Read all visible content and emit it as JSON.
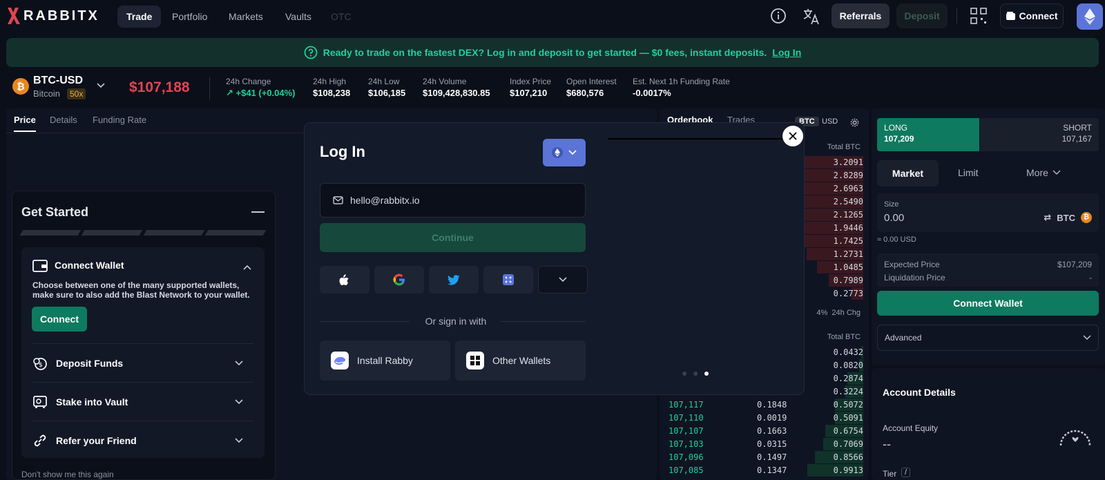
{
  "logo": {
    "text": "RABBITX"
  },
  "nav": {
    "tabs": [
      {
        "label": "Trade"
      },
      {
        "label": "Portfolio"
      },
      {
        "label": "Markets"
      },
      {
        "label": "Vaults"
      },
      {
        "label": "OTC"
      }
    ]
  },
  "topbar": {
    "referrals": "Referrals",
    "deposit": "Deposit",
    "connect": "Connect"
  },
  "banner": {
    "text": "Ready to trade on the fastest DEX? Log in and deposit to get started — $0 fees, instant deposits.",
    "link": "Log In"
  },
  "ticker": {
    "symbol": "BTC-USD",
    "name": "Bitcoin",
    "leverage": "50x",
    "price": "$107,188",
    "stats": [
      {
        "label": "24h Change",
        "value": "↗ +$41 (+0.04%)"
      },
      {
        "label": "24h High",
        "value": "$108,238"
      },
      {
        "label": "24h Low",
        "value": "$106,185"
      },
      {
        "label": "24h Volume",
        "value": "$109,428,830.85"
      },
      {
        "label": "Index Price",
        "value": "$107,210"
      },
      {
        "label": "Open Interest",
        "value": "$680,576"
      },
      {
        "label": "Est. Next 1h Funding Rate",
        "value": "-0.0017%"
      }
    ]
  },
  "chart_tabs": [
    {
      "label": "Price"
    },
    {
      "label": "Details"
    },
    {
      "label": "Funding Rate"
    }
  ],
  "get_started": {
    "title": "Get Started",
    "connect_wallet": {
      "title": "Connect Wallet",
      "description": "Choose between one of the many supported wallets, make sure to also add the Blast Network to your wallet.",
      "button": "Connect"
    },
    "items": [
      {
        "label": "Deposit Funds"
      },
      {
        "label": "Stake into Vault"
      },
      {
        "label": "Refer your Friend"
      }
    ],
    "dont_show": "Don't show me this again"
  },
  "orderbook": {
    "tabs": [
      {
        "label": "Orderbook"
      },
      {
        "label": "Trades"
      }
    ],
    "units": [
      "BTC",
      "USD"
    ],
    "col_total": "Total",
    "col_unit": "BTC",
    "ask_totals": [
      "3.2091",
      "2.8289",
      "2.6963",
      "2.5490",
      "2.1265",
      "1.9446",
      "1.7425",
      "1.2731",
      "1.0485",
      "0.7989",
      "0.2773"
    ],
    "mid": {
      "pct": "4%",
      "label": "24h Chg"
    },
    "bid_totals": [
      "0.0432",
      "0.0820",
      "0.2874",
      "0.3224",
      "0.5072",
      "0.5091",
      "0.6754",
      "0.7069",
      "0.8566",
      "0.9913"
    ],
    "bid_rows": [
      {
        "price": "107,117",
        "size": "0.1848"
      },
      {
        "price": "107,110",
        "size": "0.0019"
      },
      {
        "price": "107,107",
        "size": "0.1663"
      },
      {
        "price": "107,103",
        "size": "0.0315"
      },
      {
        "price": "107,096",
        "size": "0.1497"
      },
      {
        "price": "107,085",
        "size": "0.1347"
      }
    ]
  },
  "order_form": {
    "long_label": "LONG",
    "long_price": "107,209",
    "short_label": "SHORT",
    "short_price": "107,167",
    "tabs": [
      {
        "label": "Market"
      },
      {
        "label": "Limit"
      },
      {
        "label": "More"
      }
    ],
    "size_label": "Size",
    "size_value": "0.00",
    "size_unit": "BTC",
    "usd_equiv": "≈ 0.00 USD",
    "expected_price_label": "Expected Price",
    "expected_price": "$107,209",
    "liq_price_label": "Liquidation Price",
    "liq_price": "-",
    "connect_button": "Connect Wallet",
    "advanced": "Advanced"
  },
  "account": {
    "title": "Account Details",
    "equity_label": "Account Equity",
    "equity_value": "--",
    "tier_label": "Tier",
    "tier_value": "/"
  },
  "login_modal": {
    "title": "Log In",
    "email_value": "hello@rabbitx.io",
    "continue": "Continue",
    "divider": "Or sign in with",
    "wallets": [
      {
        "label": "Install Rabby"
      },
      {
        "label": "Other Wallets"
      }
    ]
  },
  "colors": {
    "accent": "#0e7a5f",
    "price_red": "#e0454f",
    "bid_green": "#1fd19b",
    "ask_bar": "#3a1820",
    "bid_bar": "#0f3328"
  }
}
